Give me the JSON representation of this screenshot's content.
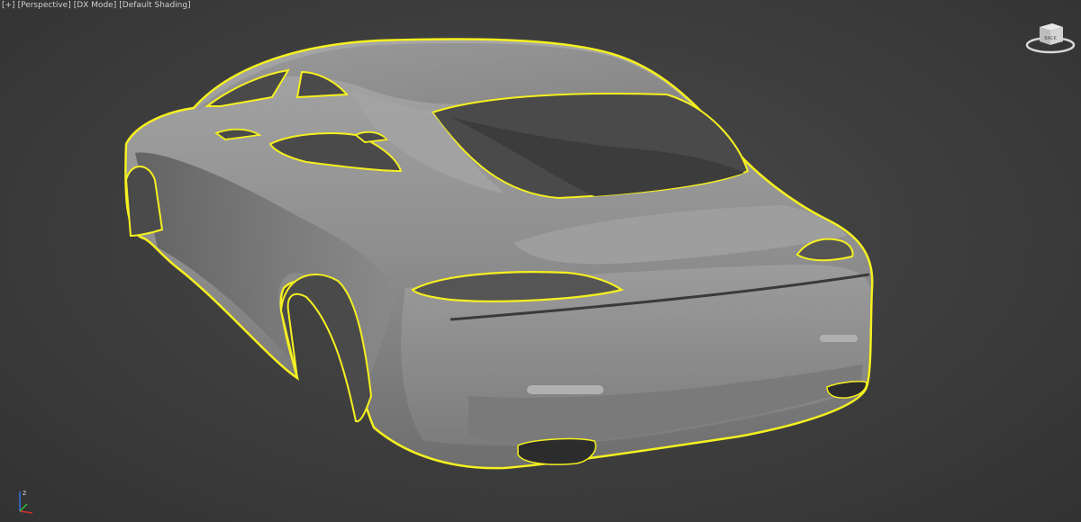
{
  "viewport": {
    "menu_plus": "[+]",
    "view_name": "[Perspective]",
    "renderer": "[DX Mode]",
    "shading": "[Default Shading]"
  },
  "viewcube": {
    "face_label": "BACK"
  },
  "colors": {
    "background": "#3c3c3c",
    "selection_outline": "#f5f020",
    "model_surface": "#8f8f8f",
    "axis_x": "#d03030",
    "axis_y": "#30c030",
    "axis_z": "#3070e0"
  },
  "axis_labels": {
    "z": "z"
  }
}
